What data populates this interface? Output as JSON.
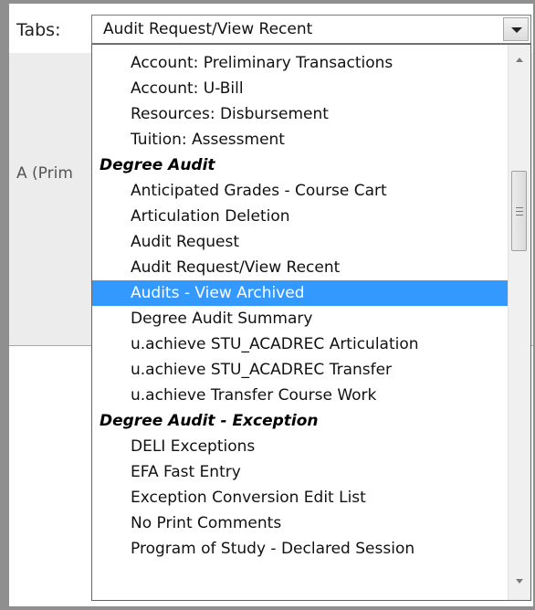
{
  "tabs": {
    "label": "Tabs:",
    "selected_value": "Audit Request/View Recent"
  },
  "background": {
    "partial_text": "A (Prim"
  },
  "dropdown": {
    "options": [
      {
        "label": "Account: Preliminary Transactions",
        "type": "option"
      },
      {
        "label": "Account: U-Bill",
        "type": "option"
      },
      {
        "label": "Resources: Disbursement",
        "type": "option"
      },
      {
        "label": "Tuition: Assessment",
        "type": "option"
      },
      {
        "label": "Degree Audit",
        "type": "group"
      },
      {
        "label": "Anticipated Grades - Course Cart",
        "type": "option"
      },
      {
        "label": "Articulation Deletion",
        "type": "option"
      },
      {
        "label": "Audit Request",
        "type": "option"
      },
      {
        "label": "Audit Request/View Recent",
        "type": "option"
      },
      {
        "label": "Audits - View Archived",
        "type": "option",
        "highlighted": true
      },
      {
        "label": "Degree Audit Summary",
        "type": "option"
      },
      {
        "label": "u.achieve STU_ACADREC Articulation",
        "type": "option"
      },
      {
        "label": "u.achieve STU_ACADREC Transfer",
        "type": "option"
      },
      {
        "label": "u.achieve Transfer Course Work",
        "type": "option"
      },
      {
        "label": "Degree Audit - Exception",
        "type": "group"
      },
      {
        "label": "DELI Exceptions",
        "type": "option"
      },
      {
        "label": "EFA Fast Entry",
        "type": "option"
      },
      {
        "label": "Exception Conversion Edit List",
        "type": "option"
      },
      {
        "label": "No Print Comments",
        "type": "option"
      },
      {
        "label": "Program of Study - Declared Session",
        "type": "option"
      }
    ]
  },
  "colors": {
    "highlight": "#3399ff",
    "frame": "#8f8f8f",
    "panel": "#ececec"
  },
  "icons": {
    "dropdown_button": "chevron-down-icon",
    "scroll_up": "scroll-up-arrow-icon",
    "scroll_down": "scroll-down-arrow-icon"
  }
}
